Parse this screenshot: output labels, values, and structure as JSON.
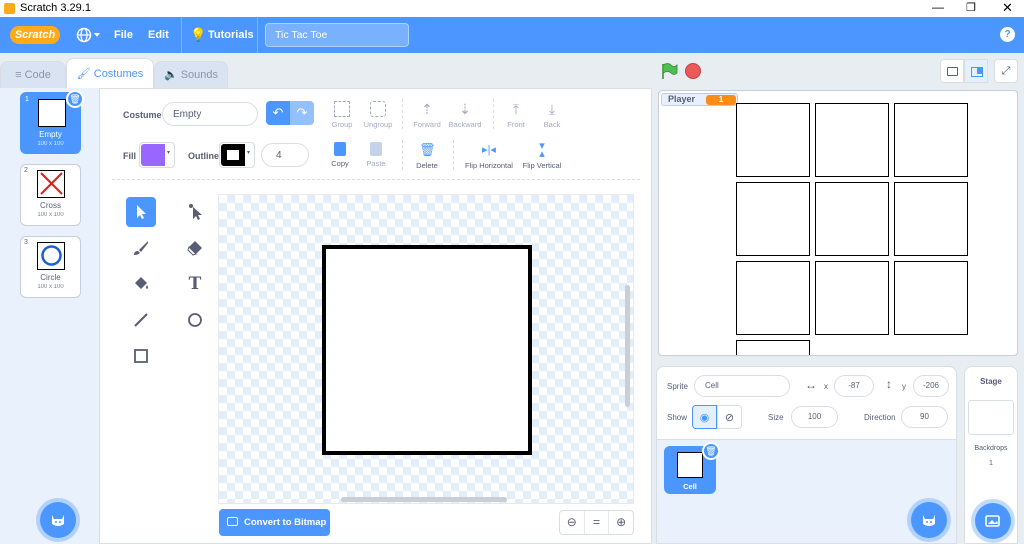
{
  "window": {
    "title": "Scratch 3.29.1"
  },
  "menubar": {
    "file": "File",
    "edit": "Edit",
    "tutorials": "Tutorials",
    "project_title": "Tic Tac Toe",
    "logo": "Scratch"
  },
  "tabs": {
    "code": "Code",
    "costumes": "Costumes",
    "sounds": "Sounds"
  },
  "costumes": [
    {
      "num": "1",
      "name": "Empty",
      "size": "100 x 100"
    },
    {
      "num": "2",
      "name": "Cross",
      "size": "100 x 100"
    },
    {
      "num": "3",
      "name": "Circle",
      "size": "100 x 100"
    }
  ],
  "editor": {
    "costume_label": "Costume",
    "costume_name": "Empty",
    "fill_label": "Fill",
    "outline_label": "Outline",
    "outline_width": "4",
    "fill_color": "#9966ff",
    "toolbar": {
      "group": "Group",
      "ungroup": "Ungroup",
      "forward": "Forward",
      "backward": "Backward",
      "front": "Front",
      "back": "Back",
      "copy": "Copy",
      "paste": "Paste",
      "delete": "Delete",
      "flip_h": "Flip Horizontal",
      "flip_v": "Flip Vertical"
    },
    "convert_button": "Convert to Bitmap"
  },
  "stage": {
    "sprite_name_label": "Player",
    "counter": "1"
  },
  "sprite_info": {
    "sprite_label": "Sprite",
    "sprite_name": "Cell",
    "x_label": "x",
    "x_value": "-87",
    "y_label": "y",
    "y_value": "-206",
    "show_label": "Show",
    "size_label": "Size",
    "size_value": "100",
    "direction_label": "Direction",
    "direction_value": "90"
  },
  "sprites": [
    {
      "name": "Cell"
    }
  ],
  "stage_pane": {
    "title": "Stage",
    "backdrops_label": "Backdrops",
    "backdrops_count": "1"
  },
  "colors": {
    "accent": "#4c97ff",
    "counter": "#ff8c1a"
  }
}
